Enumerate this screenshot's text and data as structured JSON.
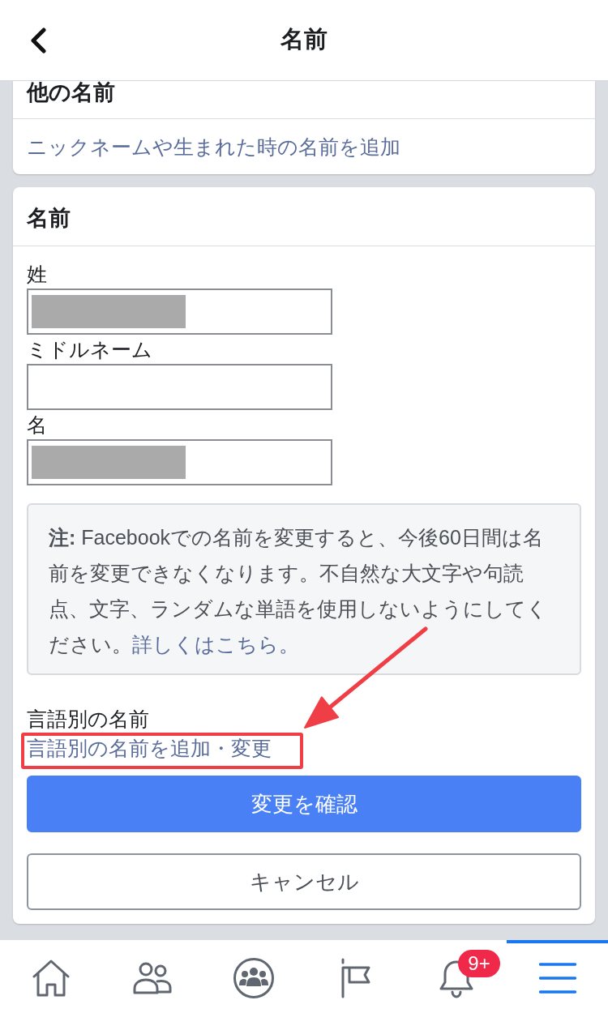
{
  "header": {
    "title": "名前"
  },
  "other_names": {
    "title": "他の名前",
    "link": "ニックネームや生まれた時の名前を追加"
  },
  "name_form": {
    "title": "名前",
    "fields": [
      {
        "label": "姓",
        "redacted": true
      },
      {
        "label": "ミドルネーム",
        "redacted": false
      },
      {
        "label": "名",
        "redacted": true
      }
    ],
    "note": "**注:** Facebookでの名前を変更すると、今後60日間は名前を変更できなくなります。不自然な大文字や句読点、文字、ランダムな単語を使用しないようにしてください。",
    "note_link": "詳しくはこちら。",
    "language_names": {
      "label": "言語別の名前",
      "link": "言語別の名前を追加・変更"
    },
    "buttons": [
      {
        "label": "変更を確認",
        "kind": "primary"
      },
      {
        "label": "キャンセル",
        "kind": "secondary"
      }
    ]
  },
  "tab_bar": {
    "tabs": [
      {
        "selected": false
      },
      {
        "selected": false
      },
      {
        "selected": false
      },
      {
        "selected": false
      },
      {
        "selected": false,
        "badge": "9+"
      },
      {
        "selected": true
      }
    ]
  }
}
